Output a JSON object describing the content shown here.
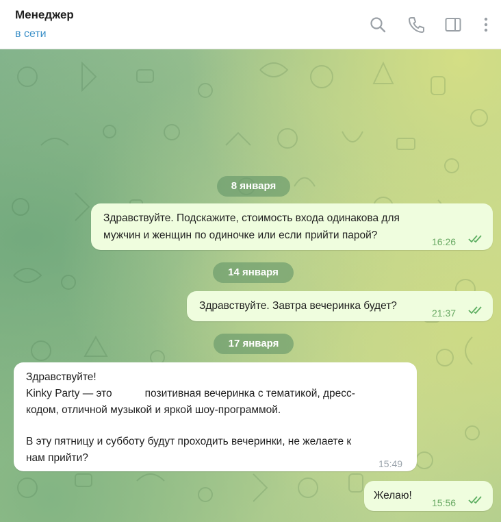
{
  "header": {
    "name": "Менеджер",
    "status": "в сети"
  },
  "colors": {
    "accent": "#3a8fc7",
    "outgoing_bubble": "#effdde",
    "incoming_bubble": "#ffffff",
    "outgoing_time": "#6aaa64",
    "incoming_time": "#9aa3ab"
  },
  "icons": [
    "search-icon",
    "phone-icon",
    "sidebar-panel-icon",
    "more-vertical-icon"
  ],
  "dates": [
    "8 января",
    "14 января",
    "17 января"
  ],
  "messages": [
    {
      "direction": "outgoing",
      "lines": [
        "Здравствуйте. Подскажите, стоимость входа одинакова для",
        "мужчин и женщин по одиночке или если прийти парой?"
      ],
      "time": "16:26",
      "read": true
    },
    {
      "direction": "outgoing",
      "lines": [
        "Здравствуйте. Завтра вечеринка будет?"
      ],
      "time": "21:37",
      "read": true
    },
    {
      "direction": "incoming",
      "lines": [
        "Здравствуйте!",
        "Kinky Party — это",
        "позитивная вечеринка с тематикой, дресс-",
        "кодом, отличной музыкой и яркой шоу-программой.",
        "В эту пятницу и субботу будут проходить вечеринки, не желаете к",
        "нам прийти?"
      ],
      "time": "15:49"
    },
    {
      "direction": "outgoing",
      "lines": [
        "Желаю!"
      ],
      "time": "15:56",
      "read": true
    }
  ]
}
